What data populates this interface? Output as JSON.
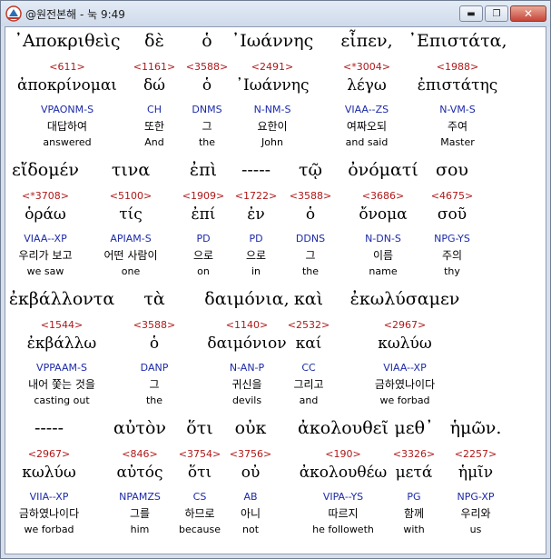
{
  "window": {
    "title": "@원전본해 - 눅 9:49"
  },
  "controls": {
    "minimize": "▬",
    "maximize": "❐",
    "close": "✕"
  },
  "rows": [
    {
      "words": [
        {
          "greek": "᾿Αποκριθεὶς",
          "strong": "<611>",
          "lemma": "ἀποκρίνομαι",
          "parse": "VPAONM-S",
          "korean": "대답하여",
          "english": "answered"
        },
        {
          "greek": "δὲ",
          "strong": "<1161>",
          "lemma": "δώ",
          "parse": "CH",
          "korean": "또한",
          "english": "And"
        },
        {
          "greek": "ὁ",
          "strong": "<3588>",
          "lemma": "ὁ",
          "parse": "DNMS",
          "korean": "그",
          "english": "the"
        },
        {
          "greek": "᾿Ιωάννης",
          "strong": "<2491>",
          "lemma": "᾿Ιωάννης",
          "parse": "N-NM-S",
          "korean": "요한이",
          "english": "John"
        },
        {
          "greek": "εἶπεν,",
          "strong": "<*3004>",
          "lemma": "λέγω",
          "parse": "VIAA--ZS",
          "korean": "여짜오되",
          "english": "and said"
        },
        {
          "greek": "᾿Επιστάτα,",
          "strong": "<1988>",
          "lemma": "ἐπιστάτης",
          "parse": "N-VM-S",
          "korean": "주여",
          "english": "Master"
        }
      ]
    },
    {
      "words": [
        {
          "greek": "εἴδομέν",
          "strong": "<*3708>",
          "lemma": "ὁράω",
          "parse": "VIAA--XP",
          "korean": "우리가 보고",
          "english": "we saw"
        },
        {
          "greek": "τινα",
          "strong": "<5100>",
          "lemma": "τίς",
          "parse": "APIAM-S",
          "korean": "어떤 사람이",
          "english": "one"
        },
        {
          "greek": "ἐπὶ",
          "strong": "<1909>",
          "lemma": "ἐπί",
          "parse": "PD",
          "korean": "으로",
          "english": "on"
        },
        {
          "greek": "-----",
          "strong": "<1722>",
          "lemma": "ἐν",
          "parse": "PD",
          "korean": "으로",
          "english": "in"
        },
        {
          "greek": "τῷ",
          "strong": "<3588>",
          "lemma": "ὁ",
          "parse": "DDNS",
          "korean": "그",
          "english": "the"
        },
        {
          "greek": "ὀνόματί",
          "strong": "<3686>",
          "lemma": "ὄνομα",
          "parse": "N-DN-S",
          "korean": "이름",
          "english": "name"
        },
        {
          "greek": "σου",
          "strong": "<4675>",
          "lemma": "σοῦ",
          "parse": "NPG-YS",
          "korean": "주의",
          "english": "thy"
        }
      ]
    },
    {
      "words": [
        {
          "greek": "ἐκβάλλοντα",
          "strong": "<1544>",
          "lemma": "ἐκβάλλω",
          "parse": "VPPAAM-S",
          "korean": "내어 쫓는 것을",
          "english": "casting out"
        },
        {
          "greek": "τὰ",
          "strong": "<3588>",
          "lemma": "ὁ",
          "parse": "DANP",
          "korean": "그",
          "english": "the"
        },
        {
          "greek": "δαιμόνια,",
          "strong": "<1140>",
          "lemma": "δαιμόνιον",
          "parse": "N-AN-P",
          "korean": "귀신을",
          "english": "devils"
        },
        {
          "greek": "καὶ",
          "strong": "<2532>",
          "lemma": "καί",
          "parse": "CC",
          "korean": "그리고",
          "english": "and"
        },
        {
          "greek": "ἐκωλύσαμεν",
          "strong": "<2967>",
          "lemma": "κωλύω",
          "parse": "VIAA--XP",
          "korean": "금하였나이다",
          "english": "we forbad"
        }
      ]
    },
    {
      "words": [
        {
          "greek": "-----",
          "strong": "<2967>",
          "lemma": "κωλύω",
          "parse": "VIIA--XP",
          "korean": "금하였나이다",
          "english": "we forbad"
        },
        {
          "greek": "αὐτὸν",
          "strong": "<846>",
          "lemma": "αὐτός",
          "parse": "NPAMZS",
          "korean": "그를",
          "english": "him"
        },
        {
          "greek": "ὅτι",
          "strong": "<3754>",
          "lemma": "ὅτι",
          "parse": "CS",
          "korean": "하므로",
          "english": "because"
        },
        {
          "greek": "οὐκ",
          "strong": "<3756>",
          "lemma": "οὐ",
          "parse": "AB",
          "korean": "아니",
          "english": "not"
        },
        {
          "greek": "ἀκολουθεῖ",
          "strong": "<190>",
          "lemma": "ἀκολουθέω",
          "parse": "VIPA--YS",
          "korean": "따르지",
          "english": "he followeth"
        },
        {
          "greek": "μεθ᾿",
          "strong": "<3326>",
          "lemma": "μετά",
          "parse": "PG",
          "korean": "함께",
          "english": "with"
        },
        {
          "greek": "ἡμῶν.",
          "strong": "<2257>",
          "lemma": "ἡμῖν",
          "parse": "NPG-XP",
          "korean": "우리와",
          "english": "us"
        }
      ]
    }
  ]
}
